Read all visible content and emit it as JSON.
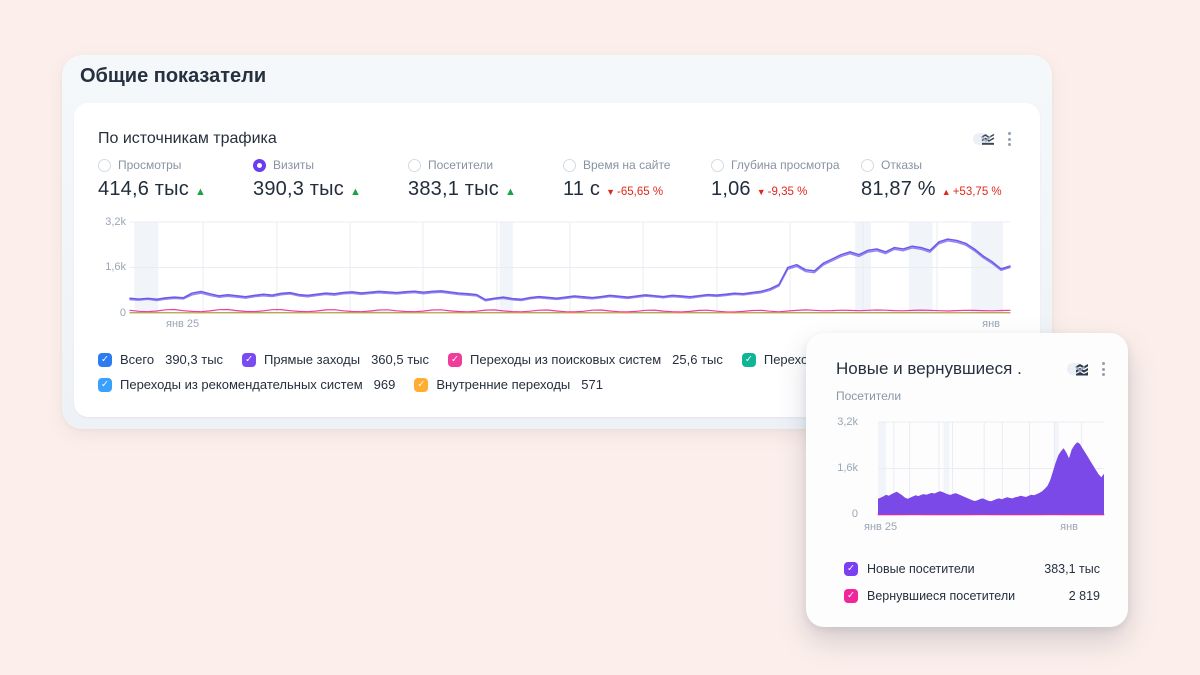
{
  "panel": {
    "title": "Общие показатели"
  },
  "traffic_card": {
    "title": "По источникам трафика",
    "toolbar": {
      "chart_type_icon": "line-chart-icon",
      "menu_icon": "kebab-menu-icon"
    },
    "metrics": [
      {
        "label": "Просмотры",
        "value": "414,6 тыс",
        "trend": "up",
        "trend_color": "#18a349",
        "delta": "",
        "selected": false
      },
      {
        "label": "Визиты",
        "value": "390,3 тыс",
        "trend": "up",
        "trend_color": "#18a349",
        "delta": "",
        "selected": true
      },
      {
        "label": "Посетители",
        "value": "383,1 тыс",
        "trend": "up",
        "trend_color": "#18a349",
        "delta": "",
        "selected": false
      },
      {
        "label": "Время на сайте",
        "value": "11 с",
        "trend": "down",
        "trend_color": "#e0281c",
        "delta": "-65,65 %",
        "selected": false
      },
      {
        "label": "Глубина просмотра",
        "value": "1,06",
        "trend": "down",
        "trend_color": "#e0281c",
        "delta": "-9,35 %",
        "selected": false
      },
      {
        "label": "Отказы",
        "value": "81,87 %",
        "trend": "up",
        "trend_color": "#e0281c",
        "delta": "+53,75 %",
        "selected": false
      }
    ],
    "legend": [
      [
        {
          "label": "Всего",
          "value": "390,3 тыс",
          "color": "#2b7cf0"
        },
        {
          "label": "Прямые заходы",
          "value": "360,5 тыс",
          "color": "#7a4bf0"
        },
        {
          "label": "Переходы из поисковых систем",
          "value": "25,6 тыс",
          "color": "#f03c9b"
        },
        {
          "label": "Переходы по ссылкам на сайтах",
          "value": "",
          "color": "#0fb595"
        }
      ],
      [
        {
          "label": "Переходы из рекомендательных систем",
          "value": "969",
          "color": "#3aa0fe"
        },
        {
          "label": "Внутренние переходы",
          "value": "571",
          "color": "#ffad33"
        }
      ]
    ]
  },
  "visitors_card": {
    "title": "Новые и вернувшиеся ...",
    "subtitle": "Посетители",
    "toolbar": {
      "chart_type_icon": "area-chart-icon",
      "menu_icon": "kebab-menu-icon"
    },
    "legend": [
      {
        "label": "Новые посетители",
        "value": "383,1 тыс",
        "color": "#7a3ff0"
      },
      {
        "label": "Вернувшиеся посетители",
        "value": "2 819",
        "color": "#f0269b"
      }
    ]
  },
  "chart_data": [
    {
      "type": "line",
      "title": "По источникам трафика",
      "xlabel": "",
      "ylabel": "",
      "ylim": [
        0,
        3200
      ],
      "yticks": [
        "0",
        "1,6k",
        "3,2k"
      ],
      "xticks": [
        "янв 25",
        "янв"
      ],
      "grid": true,
      "legend_position": "bottom",
      "layout": {
        "vgrid": [
          0.083,
          0.167,
          0.25,
          0.333,
          0.417,
          0.5,
          0.583,
          0.667,
          0.75,
          0.833,
          0.917
        ],
        "bands": [
          [
            0.005,
            0.032
          ],
          [
            0.42,
            0.435
          ],
          [
            0.824,
            0.842
          ],
          [
            0.885,
            0.912
          ],
          [
            0.956,
            0.992
          ]
        ]
      },
      "series": [
        {
          "name": "Переходы по ссылкам на сайтах",
          "kind": "line",
          "color": "#0fb595",
          "width": 1.1,
          "values": [
            14,
            18,
            12,
            16,
            20,
            15,
            11,
            17,
            21,
            14,
            12,
            18,
            16,
            13,
            19,
            15,
            12,
            17,
            20,
            14,
            11,
            16,
            19,
            13,
            15,
            18,
            14,
            12,
            16,
            15
          ]
        },
        {
          "name": "Переходы из рекомендательных систем",
          "kind": "line",
          "color": "#3aa0fe",
          "width": 1,
          "values": [
            3,
            3
          ]
        },
        {
          "name": "Внутренние переходы",
          "kind": "line",
          "color": "#ffad33",
          "width": 1,
          "values": [
            2,
            2
          ]
        },
        {
          "name": "Переходы из поисковых систем",
          "kind": "line",
          "color": "#f03c9b",
          "width": 1.2,
          "values": [
            95,
            60,
            45,
            70,
            112,
            122,
            82,
            55,
            47,
            74,
            115,
            124,
            84,
            58,
            49,
            76,
            117,
            120,
            80,
            56,
            46,
            72,
            110,
            117,
            79,
            54,
            45,
            70,
            107,
            114,
            77,
            53,
            44,
            67,
            104,
            111,
            75,
            51,
            43,
            65,
            101,
            109,
            73,
            49,
            41,
            63,
            99,
            106,
            71,
            47,
            39,
            61,
            97,
            104,
            69,
            45,
            37,
            59,
            94,
            101,
            67,
            44,
            36,
            57,
            91,
            99,
            65,
            43,
            35,
            55,
            89,
            96,
            63,
            41,
            72,
            92,
            108,
            94,
            76,
            86,
            100,
            91,
            81,
            96,
            106,
            99,
            86,
            76,
            91,
            101,
            93,
            81,
            71,
            86,
            96,
            92,
            84,
            78,
            88,
            94
          ]
        },
        {
          "name": "Прямые заходы",
          "kind": "line",
          "color": "#9282f2",
          "width": 1.5,
          "values": [
            470,
            455,
            480,
            440,
            490,
            515,
            495,
            640,
            700,
            620,
            555,
            590,
            560,
            525,
            575,
            610,
            580,
            640,
            670,
            600,
            570,
            615,
            655,
            630,
            675,
            695,
            655,
            685,
            710,
            690,
            670,
            700,
            720,
            680,
            710,
            730,
            690,
            650,
            630,
            600,
            430,
            480,
            515,
            465,
            440,
            500,
            535,
            505,
            478,
            515,
            555,
            525,
            498,
            535,
            575,
            545,
            515,
            555,
            595,
            565,
            535,
            575,
            555,
            525,
            565,
            605,
            585,
            615,
            655,
            635,
            675,
            715,
            800,
            950,
            1540,
            1640,
            1460,
            1420,
            1690,
            1840,
            1990,
            2090,
            1990,
            2140,
            2190,
            2090,
            2240,
            2190,
            2290,
            2240,
            2140,
            2440,
            2540,
            2490,
            2390,
            2190,
            1940,
            1740,
            1500,
            1600
          ]
        },
        {
          "name": "Всего",
          "kind": "line",
          "color": "#6a5ae8",
          "width": 1.5,
          "values": [
            520,
            490,
            515,
            480,
            530,
            560,
            535,
            700,
            755,
            675,
            600,
            640,
            605,
            570,
            620,
            660,
            628,
            688,
            718,
            648,
            618,
            662,
            700,
            678,
            722,
            742,
            702,
            730,
            758,
            738,
            718,
            748,
            768,
            728,
            758,
            778,
            740,
            700,
            678,
            648,
            470,
            520,
            558,
            508,
            480,
            540,
            578,
            548,
            520,
            558,
            598,
            568,
            540,
            578,
            618,
            588,
            558,
            598,
            638,
            608,
            578,
            618,
            598,
            568,
            608,
            648,
            628,
            658,
            698,
            678,
            720,
            760,
            850,
            1000,
            1600,
            1700,
            1520,
            1480,
            1750,
            1900,
            2050,
            2150,
            2050,
            2200,
            2250,
            2150,
            2300,
            2250,
            2350,
            2300,
            2200,
            2500,
            2600,
            2550,
            2450,
            2250,
            2000,
            1800,
            1550,
            1650
          ]
        }
      ]
    },
    {
      "type": "area",
      "title": "Новые и вернувшиеся посетители",
      "xlabel": "",
      "ylabel": "",
      "ylim": [
        0,
        3200
      ],
      "yticks": [
        "0",
        "1,6k",
        "3,2k"
      ],
      "xticks": [
        "янв 25",
        "янв"
      ],
      "grid": true,
      "legend_position": "bottom",
      "layout": {
        "vgrid": [
          0.07,
          0.14,
          0.27,
          0.33,
          0.47,
          0.55,
          0.67,
          0.78,
          0.9
        ],
        "bands": [
          [
            0.0,
            0.035
          ],
          [
            0.29,
            0.315
          ],
          [
            0.78,
            0.8
          ]
        ]
      },
      "series": [
        {
          "name": "Новые посетители",
          "kind": "area",
          "color": "#7a49e8",
          "values": [
            560,
            600,
            640,
            700,
            660,
            720,
            760,
            800,
            740,
            680,
            600,
            560,
            600,
            640,
            680,
            650,
            690,
            720,
            700,
            730,
            760,
            740,
            780,
            820,
            790,
            750,
            710,
            690,
            730,
            750,
            710,
            670,
            630,
            590,
            550,
            510,
            480,
            510,
            550,
            570,
            530,
            490,
            470,
            510,
            550,
            570,
            540,
            580,
            610,
            590,
            570,
            610,
            630,
            660,
            640,
            620,
            660,
            700,
            680,
            720,
            760,
            820,
            900,
            1000,
            1200,
            1500,
            1800,
            2050,
            2200,
            2300,
            2150,
            1950,
            2250,
            2400,
            2500,
            2450,
            2300,
            2150,
            2000,
            1850,
            1700,
            1550,
            1400,
            1300,
            1420
          ]
        },
        {
          "name": "Вернувшиеся посетители",
          "kind": "line",
          "color": "#f0269b",
          "width": 1,
          "values": [
            12,
            10,
            14,
            9,
            12,
            11,
            13,
            10,
            12,
            11,
            13,
            9,
            12,
            10
          ]
        }
      ]
    }
  ]
}
